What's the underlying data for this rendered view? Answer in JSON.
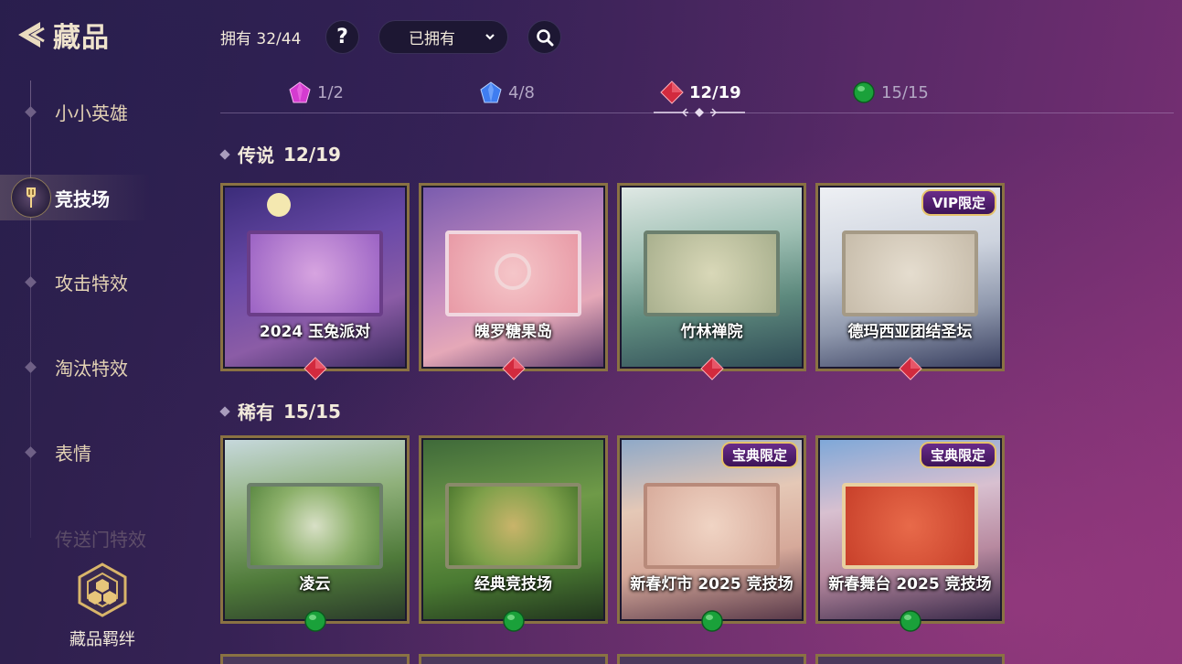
{
  "header": {
    "title": "藏品",
    "owned_count": "拥有 32/44",
    "help_label": "?",
    "filter_value": "已拥有"
  },
  "sidebar": {
    "items": [
      {
        "label": "小小英雄"
      },
      {
        "label": "竞技场"
      },
      {
        "label": "攻击特效"
      },
      {
        "label": "淘汰特效"
      },
      {
        "label": "表情"
      },
      {
        "label": "传送门特效"
      }
    ],
    "bond_label": "藏品羁绊"
  },
  "tabs": [
    {
      "count": "1/2",
      "gem": "purple-gem-icon",
      "color": "#d43bd0"
    },
    {
      "count": "4/8",
      "gem": "blue-gem-icon",
      "color": "#3f7df0"
    },
    {
      "count": "12/19",
      "gem": "red-gem-icon",
      "color": "#d22a3e"
    },
    {
      "count": "15/15",
      "gem": "green-gem-icon",
      "color": "#1aa13a"
    }
  ],
  "sections": {
    "legendary": {
      "title": "传说",
      "count": "12/19",
      "cards": [
        {
          "name": "2024 玉兔派对"
        },
        {
          "name": "魄罗糖果岛"
        },
        {
          "name": "竹林禅院"
        },
        {
          "name": "德玛西亚团结圣坛",
          "badge": "VIP限定"
        }
      ]
    },
    "rare": {
      "title": "稀有",
      "count": "15/15",
      "cards": [
        {
          "name": "凌云"
        },
        {
          "name": "经典竞技场"
        },
        {
          "name": "新春灯市 2025 竞技场",
          "badge": "宝典限定"
        },
        {
          "name": "新春舞台 2025 竞技场",
          "badge": "宝典限定"
        }
      ]
    }
  }
}
